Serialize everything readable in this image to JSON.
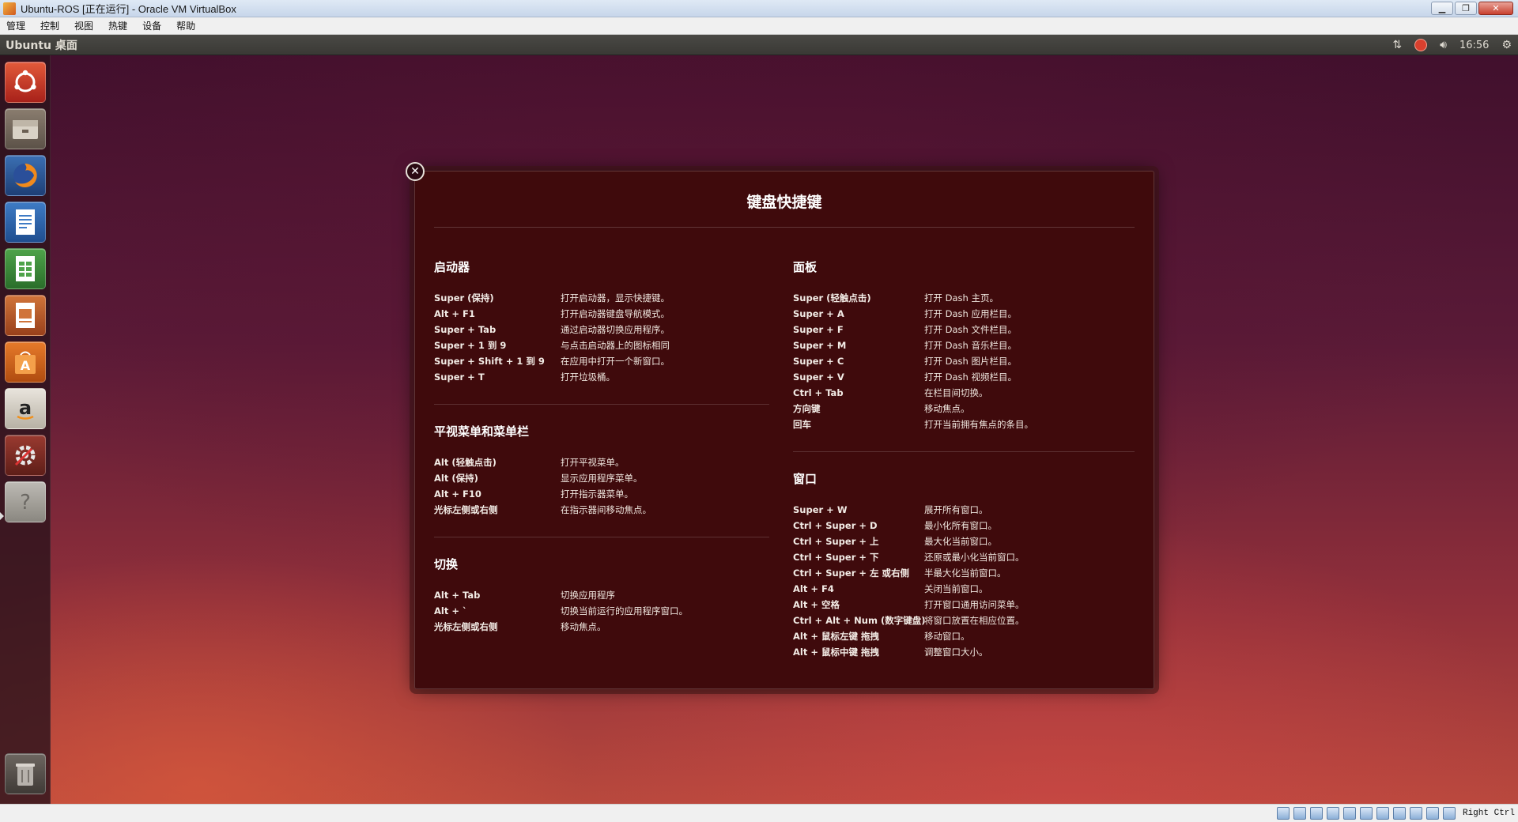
{
  "host": {
    "title": "Ubuntu-ROS [正在运行] - Oracle VM VirtualBox",
    "menu": [
      "管理",
      "控制",
      "视图",
      "热键",
      "设备",
      "帮助"
    ],
    "host_key": "Right Ctrl"
  },
  "panel": {
    "title": "Ubuntu 桌面",
    "clock": "16:56"
  },
  "launcher": {
    "items": [
      "dash-home",
      "files",
      "firefox",
      "libreoffice-writer",
      "libreoffice-calc",
      "libreoffice-impress",
      "ubuntu-software-center",
      "amazon",
      "system-settings",
      "help"
    ],
    "trash": "trash"
  },
  "overlay": {
    "title": "键盘快捷键",
    "sections": {
      "launcher": {
        "title": "启动器",
        "rows": [
          {
            "key": "Super (保持)",
            "desc": "打开启动器，显示快捷键。"
          },
          {
            "key": "Alt + F1",
            "desc": "打开启动器键盘导航模式。"
          },
          {
            "key": "Super + Tab",
            "desc": "通过启动器切换应用程序。"
          },
          {
            "key": "Super + 1 到 9",
            "desc": "与点击启动器上的图标相同"
          },
          {
            "key": "Super + Shift + 1 到 9",
            "desc": "在应用中打开一个新窗口。"
          },
          {
            "key": "Super + T",
            "desc": "打开垃圾桶。"
          }
        ]
      },
      "hud": {
        "title": "平视菜单和菜单栏",
        "rows": [
          {
            "key": "Alt (轻触点击)",
            "desc": "打开平视菜单。"
          },
          {
            "key": "Alt (保持)",
            "desc": "显示应用程序菜单。"
          },
          {
            "key": "Alt + F10",
            "desc": "打开指示器菜单。"
          },
          {
            "key": "光标左侧或右侧",
            "desc": "在指示器间移动焦点。"
          }
        ]
      },
      "switching": {
        "title": "切换",
        "rows": [
          {
            "key": "Alt + Tab",
            "desc": "切换应用程序"
          },
          {
            "key": "Alt + `",
            "desc": "切换当前运行的应用程序窗口。"
          },
          {
            "key": "光标左侧或右侧",
            "desc": "移动焦点。"
          }
        ]
      },
      "dash": {
        "title": "面板",
        "rows": [
          {
            "key": "Super (轻触点击)",
            "desc": "打开 Dash 主页。"
          },
          {
            "key": "Super + A",
            "desc": "打开 Dash 应用栏目。"
          },
          {
            "key": "Super + F",
            "desc": "打开 Dash 文件栏目。"
          },
          {
            "key": "Super + M",
            "desc": "打开 Dash 音乐栏目。"
          },
          {
            "key": "Super + C",
            "desc": "打开 Dash 图片栏目。"
          },
          {
            "key": "Super + V",
            "desc": "打开 Dash 视频栏目。"
          },
          {
            "key": "Ctrl + Tab",
            "desc": "在栏目间切换。"
          },
          {
            "key": "方向键",
            "desc": "移动焦点。"
          },
          {
            "key": "回车",
            "desc": "打开当前拥有焦点的条目。"
          }
        ]
      },
      "windows": {
        "title": "窗口",
        "rows": [
          {
            "key": "Super + W",
            "desc": "展开所有窗口。"
          },
          {
            "key": "Ctrl + Super + D",
            "desc": "最小化所有窗口。"
          },
          {
            "key": "Ctrl + Super + 上",
            "desc": "最大化当前窗口。"
          },
          {
            "key": "Ctrl + Super + 下",
            "desc": "还原或最小化当前窗口。"
          },
          {
            "key": "Ctrl + Super + 左 或右侧",
            "desc": "半最大化当前窗口。"
          },
          {
            "key": "Alt + F4",
            "desc": "关闭当前窗口。"
          },
          {
            "key": "Alt + 空格",
            "desc": "打开窗口通用访问菜单。"
          },
          {
            "key": "Ctrl + Alt + Num (数字键盘)",
            "desc": "将窗口放置在相应位置。"
          },
          {
            "key": "Alt + 鼠标左键 拖拽",
            "desc": "移动窗口。"
          },
          {
            "key": "Alt + 鼠标中键 拖拽",
            "desc": "调整窗口大小。"
          }
        ]
      }
    }
  }
}
